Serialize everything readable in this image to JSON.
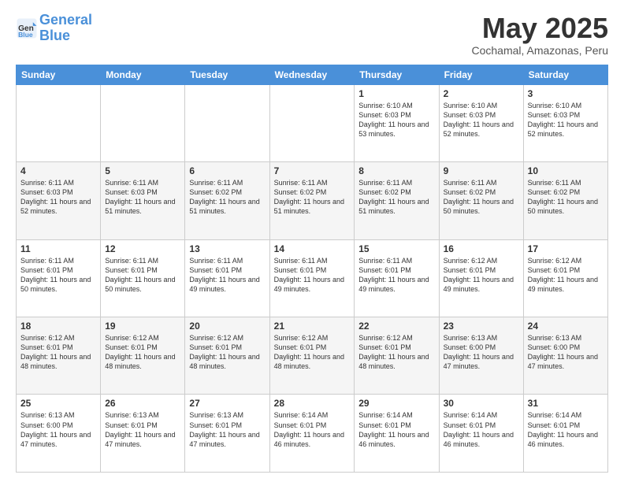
{
  "header": {
    "logo_line1": "General",
    "logo_line2": "Blue",
    "month_title": "May 2025",
    "location": "Cochamal, Amazonas, Peru"
  },
  "weekdays": [
    "Sunday",
    "Monday",
    "Tuesday",
    "Wednesday",
    "Thursday",
    "Friday",
    "Saturday"
  ],
  "weeks": [
    [
      {
        "day": "",
        "sunrise": "",
        "sunset": "",
        "daylight": ""
      },
      {
        "day": "",
        "sunrise": "",
        "sunset": "",
        "daylight": ""
      },
      {
        "day": "",
        "sunrise": "",
        "sunset": "",
        "daylight": ""
      },
      {
        "day": "",
        "sunrise": "",
        "sunset": "",
        "daylight": ""
      },
      {
        "day": "1",
        "sunrise": "6:10 AM",
        "sunset": "6:03 PM",
        "daylight": "11 hours and 53 minutes."
      },
      {
        "day": "2",
        "sunrise": "6:10 AM",
        "sunset": "6:03 PM",
        "daylight": "11 hours and 52 minutes."
      },
      {
        "day": "3",
        "sunrise": "6:10 AM",
        "sunset": "6:03 PM",
        "daylight": "11 hours and 52 minutes."
      }
    ],
    [
      {
        "day": "4",
        "sunrise": "6:11 AM",
        "sunset": "6:03 PM",
        "daylight": "11 hours and 52 minutes."
      },
      {
        "day": "5",
        "sunrise": "6:11 AM",
        "sunset": "6:03 PM",
        "daylight": "11 hours and 51 minutes."
      },
      {
        "day": "6",
        "sunrise": "6:11 AM",
        "sunset": "6:02 PM",
        "daylight": "11 hours and 51 minutes."
      },
      {
        "day": "7",
        "sunrise": "6:11 AM",
        "sunset": "6:02 PM",
        "daylight": "11 hours and 51 minutes."
      },
      {
        "day": "8",
        "sunrise": "6:11 AM",
        "sunset": "6:02 PM",
        "daylight": "11 hours and 51 minutes."
      },
      {
        "day": "9",
        "sunrise": "6:11 AM",
        "sunset": "6:02 PM",
        "daylight": "11 hours and 50 minutes."
      },
      {
        "day": "10",
        "sunrise": "6:11 AM",
        "sunset": "6:02 PM",
        "daylight": "11 hours and 50 minutes."
      }
    ],
    [
      {
        "day": "11",
        "sunrise": "6:11 AM",
        "sunset": "6:01 PM",
        "daylight": "11 hours and 50 minutes."
      },
      {
        "day": "12",
        "sunrise": "6:11 AM",
        "sunset": "6:01 PM",
        "daylight": "11 hours and 50 minutes."
      },
      {
        "day": "13",
        "sunrise": "6:11 AM",
        "sunset": "6:01 PM",
        "daylight": "11 hours and 49 minutes."
      },
      {
        "day": "14",
        "sunrise": "6:11 AM",
        "sunset": "6:01 PM",
        "daylight": "11 hours and 49 minutes."
      },
      {
        "day": "15",
        "sunrise": "6:11 AM",
        "sunset": "6:01 PM",
        "daylight": "11 hours and 49 minutes."
      },
      {
        "day": "16",
        "sunrise": "6:12 AM",
        "sunset": "6:01 PM",
        "daylight": "11 hours and 49 minutes."
      },
      {
        "day": "17",
        "sunrise": "6:12 AM",
        "sunset": "6:01 PM",
        "daylight": "11 hours and 49 minutes."
      }
    ],
    [
      {
        "day": "18",
        "sunrise": "6:12 AM",
        "sunset": "6:01 PM",
        "daylight": "11 hours and 48 minutes."
      },
      {
        "day": "19",
        "sunrise": "6:12 AM",
        "sunset": "6:01 PM",
        "daylight": "11 hours and 48 minutes."
      },
      {
        "day": "20",
        "sunrise": "6:12 AM",
        "sunset": "6:01 PM",
        "daylight": "11 hours and 48 minutes."
      },
      {
        "day": "21",
        "sunrise": "6:12 AM",
        "sunset": "6:01 PM",
        "daylight": "11 hours and 48 minutes."
      },
      {
        "day": "22",
        "sunrise": "6:12 AM",
        "sunset": "6:01 PM",
        "daylight": "11 hours and 48 minutes."
      },
      {
        "day": "23",
        "sunrise": "6:13 AM",
        "sunset": "6:00 PM",
        "daylight": "11 hours and 47 minutes."
      },
      {
        "day": "24",
        "sunrise": "6:13 AM",
        "sunset": "6:00 PM",
        "daylight": "11 hours and 47 minutes."
      }
    ],
    [
      {
        "day": "25",
        "sunrise": "6:13 AM",
        "sunset": "6:00 PM",
        "daylight": "11 hours and 47 minutes."
      },
      {
        "day": "26",
        "sunrise": "6:13 AM",
        "sunset": "6:01 PM",
        "daylight": "11 hours and 47 minutes."
      },
      {
        "day": "27",
        "sunrise": "6:13 AM",
        "sunset": "6:01 PM",
        "daylight": "11 hours and 47 minutes."
      },
      {
        "day": "28",
        "sunrise": "6:14 AM",
        "sunset": "6:01 PM",
        "daylight": "11 hours and 46 minutes."
      },
      {
        "day": "29",
        "sunrise": "6:14 AM",
        "sunset": "6:01 PM",
        "daylight": "11 hours and 46 minutes."
      },
      {
        "day": "30",
        "sunrise": "6:14 AM",
        "sunset": "6:01 PM",
        "daylight": "11 hours and 46 minutes."
      },
      {
        "day": "31",
        "sunrise": "6:14 AM",
        "sunset": "6:01 PM",
        "daylight": "11 hours and 46 minutes."
      }
    ]
  ]
}
